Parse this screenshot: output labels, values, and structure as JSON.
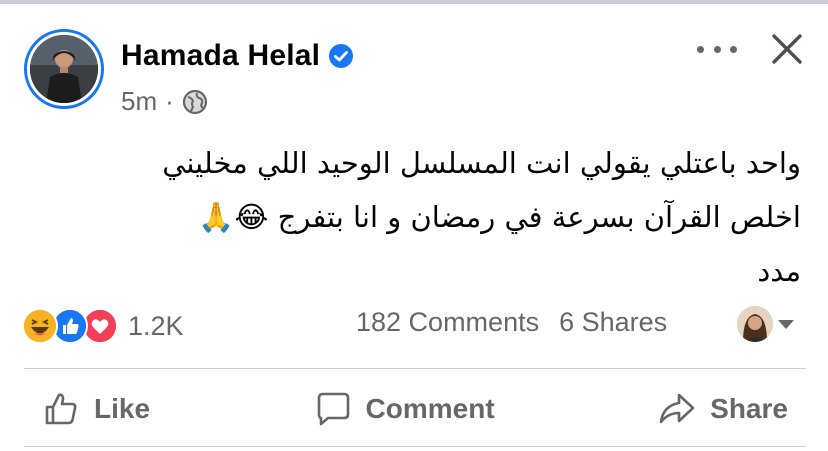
{
  "post": {
    "author": "Hamada Helal",
    "time": "5m",
    "separator": "·",
    "text_lines": [
      "واحد باعتلي يقولي انت المسلسل الوحيد اللي مخليني",
      "اخلص القرآن بسرعة في رمضان و انا بتفرج 😂🙏",
      "مدد"
    ]
  },
  "engagement": {
    "reaction_count": "1.2K",
    "comments": "182 Comments",
    "shares": "6 Shares"
  },
  "actions": {
    "like": "Like",
    "comment": "Comment",
    "share": "Share"
  },
  "colors": {
    "accent": "#1877f2",
    "muted": "#65676b",
    "divider": "#ced0d4",
    "love": "#f33e58",
    "haha": "#f7b125"
  },
  "icons": {
    "verified": "verified-badge-icon",
    "audience": "globe-icon",
    "more": "more-options-icon",
    "close": "close-icon",
    "like": "thumbs-up-icon",
    "comment": "comment-bubble-icon",
    "share": "share-arrow-icon"
  }
}
